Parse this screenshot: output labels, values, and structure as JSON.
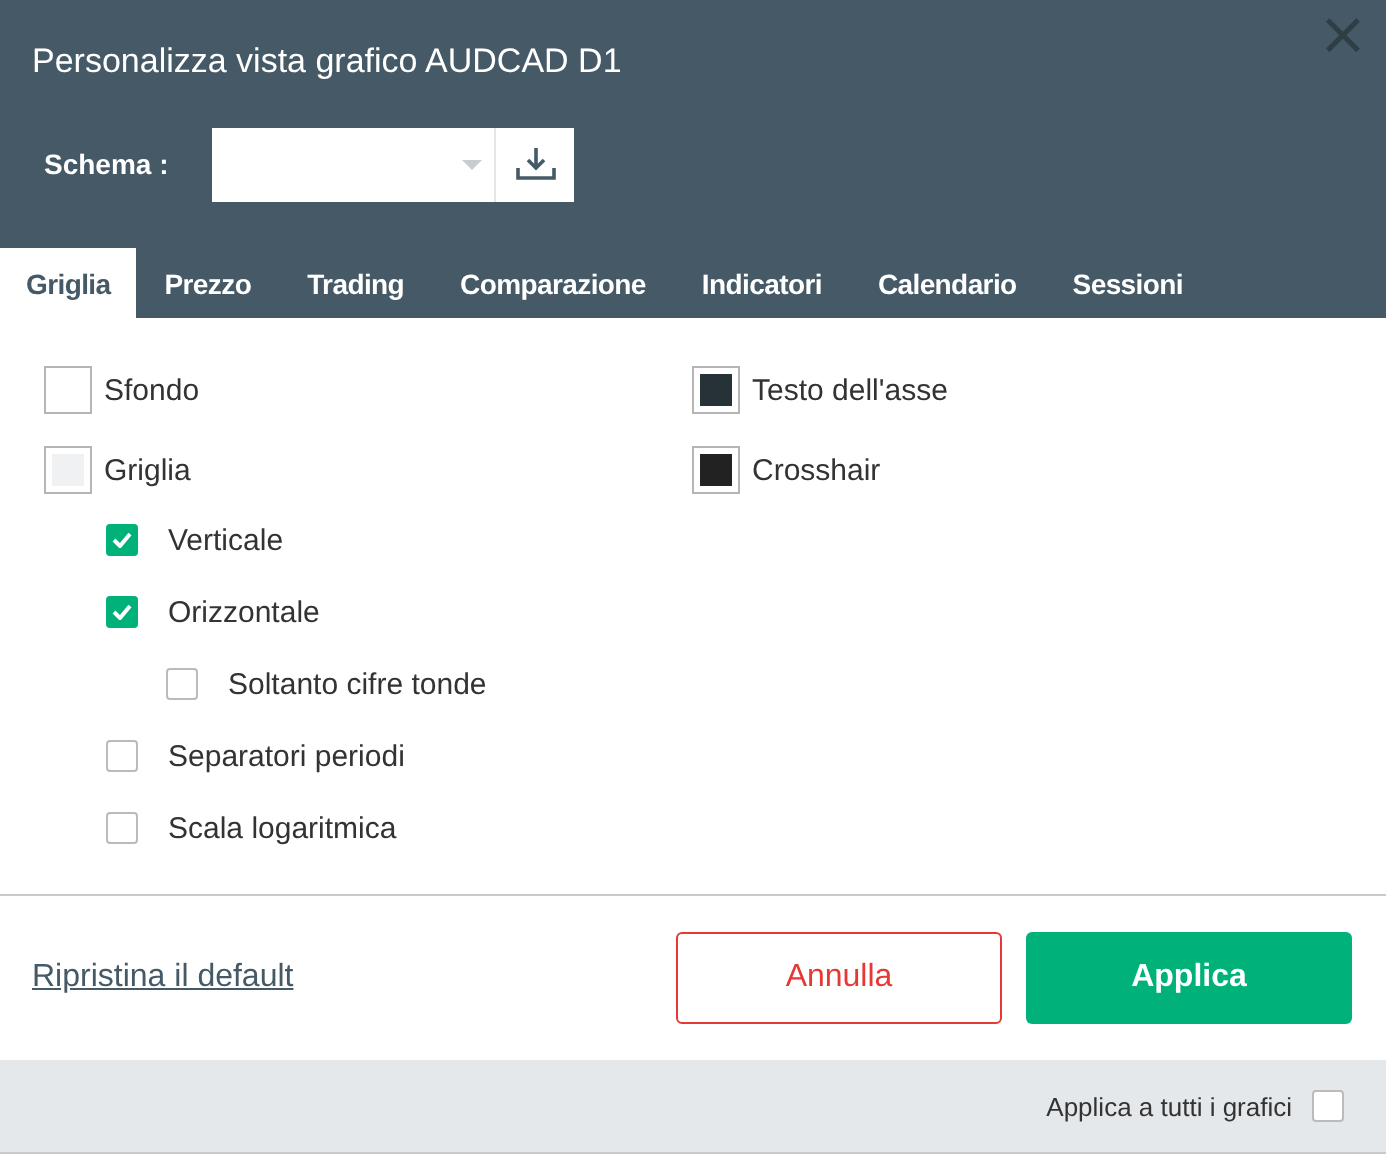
{
  "window": {
    "title": "Personalizza vista grafico AUDCAD D1",
    "close": "×"
  },
  "schema": {
    "label": "Schema :"
  },
  "tabs": [
    {
      "label": "Griglia",
      "selected": true
    },
    {
      "label": "Prezzo",
      "selected": false
    },
    {
      "label": "Trading",
      "selected": false
    },
    {
      "label": "Comparazione",
      "selected": false
    },
    {
      "label": "Indicatori",
      "selected": false
    },
    {
      "label": "Calendario",
      "selected": false
    },
    {
      "label": "Sessioni",
      "selected": false
    }
  ],
  "color_settings": [
    {
      "label": "Sfondo",
      "color": "#ffffff"
    },
    {
      "label": "Testo dell'asse",
      "color": "#263238"
    },
    {
      "label": "Griglia",
      "color": "#f0f1f3"
    },
    {
      "label": "Crosshair",
      "color": "#222222"
    }
  ],
  "grid_options": [
    {
      "label": "Verticale",
      "checked": true
    },
    {
      "label": "Orizzontale",
      "checked": true,
      "children": [
        {
          "label": "Soltanto cifre tonde",
          "checked": false
        }
      ]
    },
    {
      "label": "Separatori periodi",
      "checked": false
    },
    {
      "label": "Scala logaritmica",
      "checked": false
    }
  ],
  "reset_link": "Ripristina il default",
  "buttons": [
    {
      "label": "Annulla",
      "kind": "cancel"
    },
    {
      "label": "Applica",
      "kind": "primary"
    }
  ],
  "apply_all": {
    "label": "Applica a tutti i grafici",
    "checked": false
  }
}
